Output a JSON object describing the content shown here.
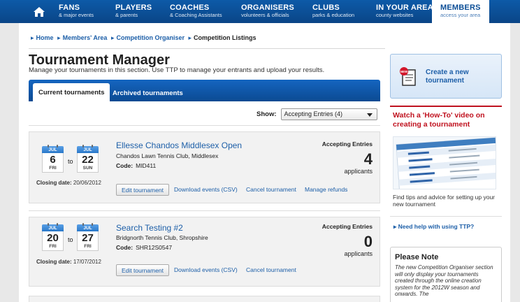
{
  "nav": {
    "home_icon": "home-icon",
    "items": [
      {
        "title": "FANS",
        "sub": "& major events"
      },
      {
        "title": "PLAYERS",
        "sub": "& parents"
      },
      {
        "title": "COACHES",
        "sub": "& Coaching Assistants"
      },
      {
        "title": "ORGANISERS",
        "sub": "volunteers & officials"
      },
      {
        "title": "CLUBS",
        "sub": "parks & education"
      },
      {
        "title": "IN YOUR AREA",
        "sub": "county websites"
      },
      {
        "title": "MEMBERS",
        "sub": "access your area"
      }
    ],
    "active": "MEMBERS"
  },
  "breadcrumb": [
    "Home",
    "Members' Area",
    "Competition Organiser",
    "Competition Listings"
  ],
  "page": {
    "title": "Tournament Manager",
    "subtitle": "Manage your tournaments in this section. Use TTP to manage your entrants and upload your results."
  },
  "tabs": [
    {
      "label": "Current tournaments",
      "active": true
    },
    {
      "label": "Archived tournaments",
      "active": false
    }
  ],
  "filter": {
    "label": "Show:",
    "value": "Accepting Entries (4)"
  },
  "tournaments": [
    {
      "start": {
        "month": "JUL",
        "day": "6",
        "weekday": "FRI"
      },
      "to": "to",
      "end": {
        "month": "JUL",
        "day": "22",
        "weekday": "SUN"
      },
      "closing_label": "Closing date:",
      "closing_date": "20/06/2012",
      "name": "Ellesse Chandos Middlesex Open",
      "venue": "Chandos Lawn Tennis Club, Middlesex",
      "code_label": "Code:",
      "code": "MID411",
      "status": "Accepting Entries",
      "count": "4",
      "count_label": "applicants",
      "actions": {
        "edit": "Edit tournament",
        "download": "Download events (CSV)",
        "cancel": "Cancel tournament",
        "refunds": "Manage refunds"
      }
    },
    {
      "start": {
        "month": "JUL",
        "day": "20",
        "weekday": "FRI"
      },
      "to": "to",
      "end": {
        "month": "JUL",
        "day": "27",
        "weekday": "FRI"
      },
      "closing_label": "Closing date:",
      "closing_date": "17/07/2012",
      "name": "Search Testing #2",
      "venue": "Bridgnorth Tennis Club, Shropshire",
      "code_label": "Code:",
      "code": "SHR12S0547",
      "status": "Accepting Entries",
      "count": "0",
      "count_label": "applicants",
      "actions": {
        "edit": "Edit tournament",
        "download": "Download events (CSV)",
        "cancel": "Cancel tournament"
      }
    }
  ],
  "sidebar": {
    "create": {
      "label": "Create a new tournament",
      "badge": "NEW",
      "icon": "new-document-icon"
    },
    "video": {
      "title": "Watch a 'How-To' video on creating a tournament",
      "desc": "Find tips and advice for setting up your new tournament"
    },
    "help_link": "Need help with using TTP?",
    "note": {
      "title": "Please Note",
      "text": "The new Competition Organiser section will only display your tournaments created through the online creation system for the 2012W season and onwards. The"
    }
  },
  "colors": {
    "brand_blue": "#0a4d96",
    "link_blue": "#1d5fa8",
    "accent_red": "#c0121f"
  }
}
